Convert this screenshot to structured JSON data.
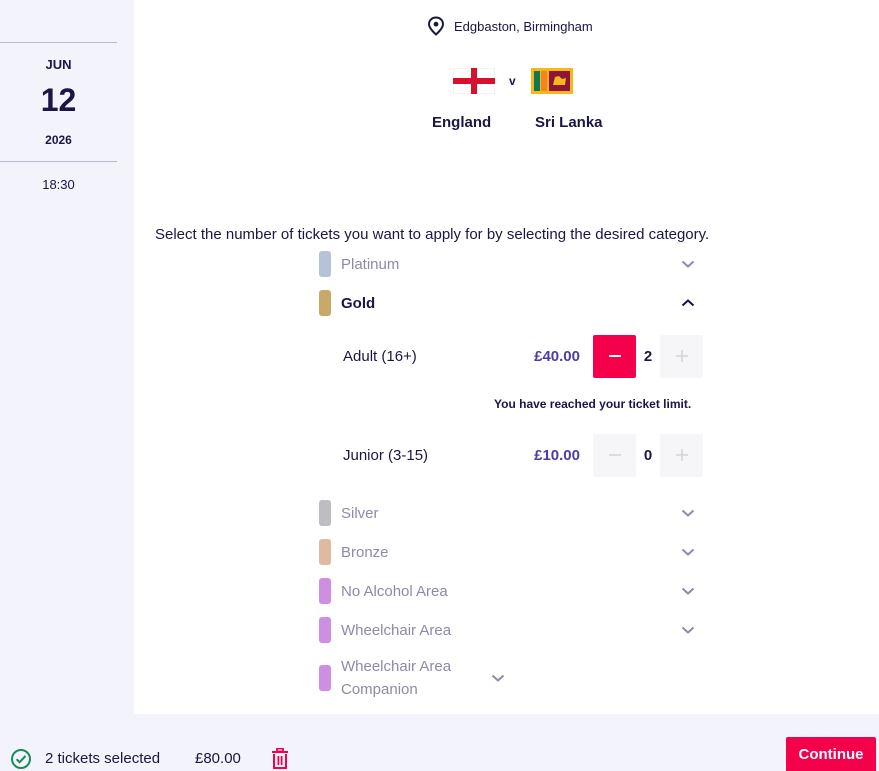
{
  "event": {
    "venue": "Edgbaston, Birmingham",
    "date_month": "JUN",
    "date_day": "12",
    "date_year": "2026",
    "time": "18:30",
    "home_team": "England",
    "vs_label": "v",
    "away_team": "Sri Lanka"
  },
  "instructions": "Select the number of tickets you want to apply for by selecting the desired category.",
  "categories": [
    {
      "label": "Platinum",
      "color": "#b5c3d8",
      "expanded": false
    },
    {
      "label": "Gold",
      "color": "#c9a96a",
      "expanded": true
    },
    {
      "label": "Silver",
      "color": "#bdbdc2",
      "expanded": false
    },
    {
      "label": "Bronze",
      "color": "#dfb9a0",
      "expanded": false
    },
    {
      "label": "No Alcohol Area",
      "color": "#cf8fe0",
      "expanded": false
    },
    {
      "label": "Wheelchair Area",
      "color": "#cf8fe0",
      "expanded": false
    },
    {
      "label": "Wheelchair Area Companion",
      "color": "#cf8fe0",
      "expanded": false
    }
  ],
  "gold_tickets": [
    {
      "name": "Adult (16+)",
      "price": "£40.00",
      "quantity": "2"
    },
    {
      "name": "Junior (3-15)",
      "price": "£10.00",
      "quantity": "0"
    }
  ],
  "limit_message": "You have reached your ticket limit.",
  "footer": {
    "tickets_selected": "2 tickets selected",
    "total": "£80.00",
    "continue_label": "Continue"
  },
  "colors": {
    "accent": "#f5004b",
    "price": "#4f3aa6",
    "text": "#1a1645",
    "muted": "#8e8aa8",
    "sidebar_bg": "#f3f3fb"
  },
  "icons": {
    "venue": "map-pin-icon",
    "expand": "chevron-down-icon",
    "collapse": "chevron-up-icon",
    "decrement": "minus-icon",
    "increment": "plus-icon",
    "selected": "check-circle-icon",
    "remove": "trash-icon"
  }
}
